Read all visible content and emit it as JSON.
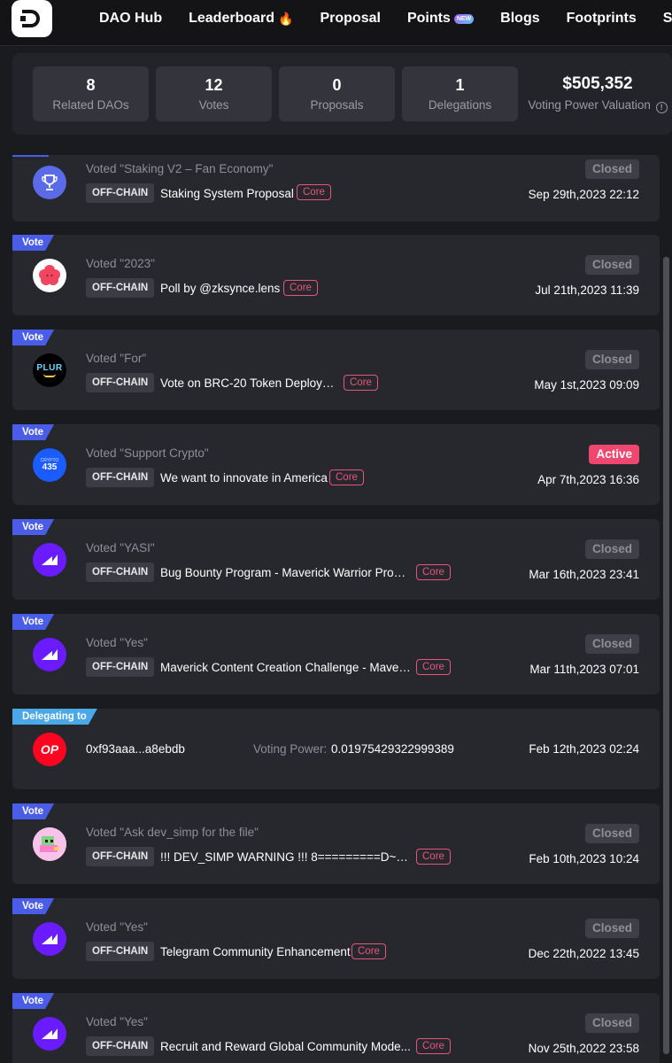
{
  "nav": {
    "items": [
      "DAO Hub",
      "Leaderboard",
      "Proposal",
      "Points",
      "Blogs",
      "Footprints",
      "Serv"
    ],
    "new_badge": "NEW"
  },
  "stats": [
    {
      "value": "8",
      "label": "Related DAOs"
    },
    {
      "value": "12",
      "label": "Votes"
    },
    {
      "value": "0",
      "label": "Proposals"
    },
    {
      "value": "1",
      "label": "Delegations"
    }
  ],
  "valuation": {
    "value": "$505,352",
    "label": "Voting Power Valuation"
  },
  "chip_label": "OFF-CHAIN",
  "core_label": "Core",
  "vote_tag": "Vote",
  "deleg_tag": "Delegating to",
  "activities": [
    {
      "voted": "Voted \"Staking V2 – Fan Economy\"",
      "title": "Staking System Proposal",
      "status": "Closed",
      "date": "Sep 29th,2023 22:12",
      "avatar": "trophy"
    },
    {
      "voted": "Voted \"2023\"",
      "title": "Poll by @zksynce.lens",
      "status": "Closed",
      "date": "Jul 21th,2023 11:39",
      "avatar": "lens"
    },
    {
      "voted": "Voted \"For\"",
      "title": "Vote on BRC-20 Token Deploy 🧪",
      "status": "Closed",
      "date": "May 1st,2023 09:09",
      "avatar": "plur"
    },
    {
      "voted": "Voted \"Support Crypto\"",
      "title": "We want to innovate in America",
      "status": "Active",
      "date": "Apr 7th,2023 16:36",
      "avatar": "crypto435"
    },
    {
      "voted": "Voted \"YASI\"",
      "title": "Bug Bounty Program - Maverick Warrior Progr...",
      "status": "Closed",
      "date": "Mar 16th,2023 23:41",
      "avatar": "maverick"
    },
    {
      "voted": "Voted \"Yes\"",
      "title": "Maverick Content Creation Challenge - Maver...",
      "status": "Closed",
      "date": "Mar 11th,2023 07:01",
      "avatar": "maverick"
    },
    {
      "voted": "Voted \"Ask dev_simp for the file\"",
      "title": "!!! DEV_SIMP WARNING !!! 8=========D~~~...",
      "status": "Closed",
      "date": "Feb 10th,2023 10:24",
      "avatar": "pixel"
    },
    {
      "voted": "Voted \"Yes\"",
      "title": "Telegram Community Enhancement",
      "status": "Closed",
      "date": "Dec 22th,2022 13:45",
      "avatar": "maverick"
    },
    {
      "voted": "Voted \"Yes\"",
      "title": "Recruit and Reward Global Community Mode...",
      "status": "Closed",
      "date": "Nov 25th,2022 23:58",
      "avatar": "maverick"
    }
  ],
  "delegation": {
    "address": "0xf93aaa...a8ebdb",
    "power_label": "Voting Power:",
    "power_value": "0.01975429322999389",
    "date": "Feb 12th,2023 02:24",
    "avatar_text": "OP"
  },
  "avatar_texts": {
    "plur": "PLUR",
    "crypto_top": "CRYPTO",
    "crypto_num": "435"
  },
  "colors": {
    "vote_tag": "#4a5de8",
    "deleg_tag": "#4aa8e8",
    "core": "#e8557b",
    "active": "#f0476f",
    "op": "#ff0420",
    "maverick": "#6a1bff"
  }
}
